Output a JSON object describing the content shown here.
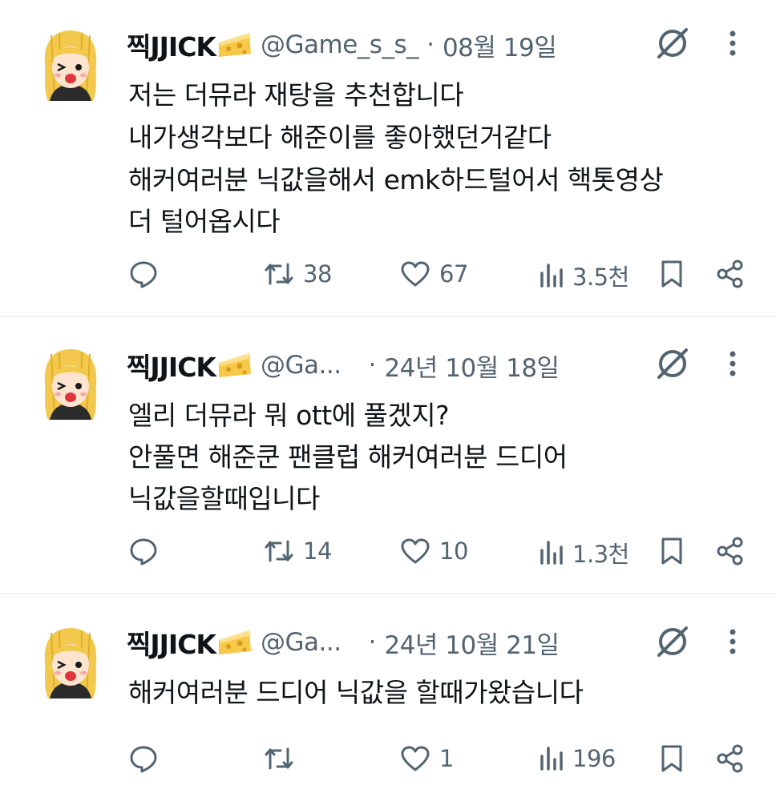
{
  "tweets": [
    {
      "name": "찍JJICK",
      "handle": "@Game_s_s_",
      "dot": "·",
      "date": "08월 19일",
      "lines": [
        "저는 더뮤라 재탕을 추천합니다",
        "내가생각보다 해준이를 좋아했던거같다",
        "해커여러분 닉값을해서 emk하드털어서 핵톳영상",
        "더 털어옵시다"
      ],
      "replies": "",
      "retweets": "38",
      "likes": "67",
      "views": "3.5천"
    },
    {
      "name": "찍JJICK",
      "handle": "@Ga...",
      "dot": "·",
      "date": "24년 10월 18일",
      "lines": [
        "엘리 더뮤라 뭐 ott에 풀겠지?",
        "안풀면 해준쿤 팬클럽 해커여러분 드디어",
        "닉값을할때입니다"
      ],
      "replies": "",
      "retweets": "14",
      "likes": "10",
      "views": "1.3천"
    },
    {
      "name": "찍JJICK",
      "handle": "@Ga...",
      "dot": "·",
      "date": "24년 10월 21일",
      "lines": [
        "해커여러분 드디어 닉값을 할때가왔습니다"
      ],
      "replies": "",
      "retweets": "",
      "likes": "1",
      "views": "196"
    }
  ],
  "icons": {
    "avatar": "cartoon-girl-avatar",
    "badge": "cheese-emoji",
    "grok": "grok-icon",
    "more": "more-vertical-icon",
    "reply": "reply-icon",
    "retweet": "retweet-icon",
    "like": "heart-icon",
    "views": "views-icon",
    "bookmark": "bookmark-icon",
    "share": "share-icon"
  },
  "colors": {
    "text": "#0f1419",
    "muted": "#536471",
    "divider": "#eff3f4",
    "hair": "#f2c94c"
  }
}
